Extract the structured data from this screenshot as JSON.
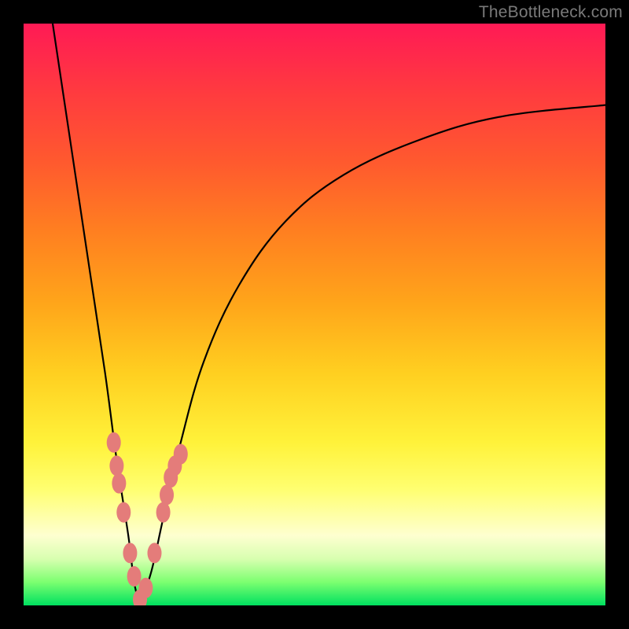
{
  "watermark": "TheBottleneck.com",
  "colors": {
    "frame": "#000000",
    "curve_stroke": "#000000",
    "marker_fill": "#e47c7a",
    "gradient_top": "#ff1a55",
    "gradient_bottom": "#00e060"
  },
  "chart_data": {
    "type": "line",
    "title": "",
    "xlabel": "",
    "ylabel": "",
    "xlim": [
      0,
      100
    ],
    "ylim": [
      0,
      100
    ],
    "grid": false,
    "legend": false,
    "note": "V-shaped bottleneck curve: x is a component scale (0-100), y is bottleneck percentage (0 at bottom, 100 at top). Minimum at x≈20.",
    "series": [
      {
        "name": "left_branch",
        "x": [
          5,
          8,
          11,
          14,
          16,
          18,
          19,
          20
        ],
        "values": [
          100,
          80,
          60,
          40,
          25,
          12,
          4,
          0
        ]
      },
      {
        "name": "right_branch",
        "x": [
          20,
          22,
          24,
          27,
          31,
          37,
          45,
          55,
          68,
          82,
          100
        ],
        "values": [
          0,
          6,
          15,
          28,
          42,
          55,
          66,
          74,
          80,
          84,
          86
        ]
      }
    ],
    "markers": {
      "name": "data-points",
      "x": [
        15.5,
        16.0,
        16.4,
        17.2,
        18.3,
        19.0,
        20.0,
        21.0,
        22.5,
        24.0,
        24.6,
        25.3,
        26.0,
        27.0
      ],
      "values": [
        28,
        24,
        21,
        16,
        9,
        5,
        1,
        3,
        9,
        16,
        19,
        22,
        24,
        26
      ]
    }
  }
}
